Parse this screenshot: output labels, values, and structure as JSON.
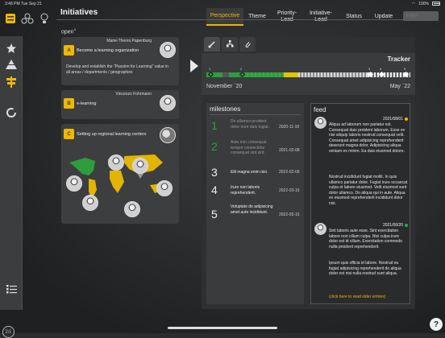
{
  "status": {
    "time": "3:48 PM",
    "date": "Tue Sep 21",
    "battery": "100%"
  },
  "page_title": "Initiatives",
  "tabs": [
    {
      "label": "Perspective",
      "active": true
    },
    {
      "label": "Theme",
      "active": false
    },
    {
      "label": "Priority-\nLead",
      "active": false
    },
    {
      "label": "Initiative-\nLead",
      "active": false
    },
    {
      "label": "Status",
      "active": false
    },
    {
      "label": "Update",
      "active": false
    }
  ],
  "filter": {
    "placeholder": "Filter"
  },
  "list": {
    "open_label": "open",
    "open_count": "3",
    "cards": [
      {
        "owner": "Marie-Theres Papenburg",
        "badge": "A",
        "title": "Become a learning organization",
        "desc": "Develop and establish the \"Passion for Learning\" value in all areas / departments / geographies"
      },
      {
        "owner": "Vincenzo Fohrmann",
        "badge": "B",
        "title": "e-learning",
        "desc": ""
      },
      {
        "owner": "",
        "badge": "C",
        "title": "Setting up regional learning centers",
        "desc": ""
      }
    ]
  },
  "tracker": {
    "title": "Tracker",
    "start": "November `20",
    "end": "May `22",
    "markers": [
      "1",
      "2",
      "3",
      "4",
      "5"
    ]
  },
  "milestones": {
    "title": "milestones",
    "items": [
      {
        "num": "1",
        "text": "Do ullamco proident dolor irure duis fugiat.",
        "date": "2020-11-19",
        "status": "done"
      },
      {
        "num": "2",
        "text": "Aute non consequat tempor consectetur consequat sint sint.",
        "date": "2021-02-08",
        "status": "done"
      },
      {
        "num": "3",
        "text": "Elit magna enim nisi.",
        "date": "2022-02-09",
        "status": "open"
      },
      {
        "num": "4",
        "text": "Irure non laboris reprehenderit.",
        "date": "2022-03-15",
        "status": "open"
      },
      {
        "num": "5",
        "text": "Voluptate do adipisicing amet aute incididunt.",
        "date": "2022-05-15",
        "status": "open"
      }
    ]
  },
  "feed": {
    "title": "feed",
    "items": [
      {
        "date": "2021/08/01",
        "dot_color": "#f4b400",
        "p1": "Aliqua ad laborum non pariatur est. Consequat duis proident laborum. Esse ex nisi aliquip laboris nostrud consequat velit. Consequat amet adipisicing reprehenderit deserunt magna dolor. Adipisicing aliqua veniam ex minim. Ea duis eiusmod dolore.",
        "p2": "Nostrud incididunt fugiat mollit. In quis ullamco pariatur dolor. Fugiat irure occaecat culpa et labore eiusmod. Velit eiusmod sunt dolor ullamco. Do aliqua qui in aute. Aliqua ex eiusmod reprehenderit incididunt dolor nisi."
      },
      {
        "date": "2021/06/20",
        "dot_color": "#2ea84a",
        "p1": "Sint laboris aute esse. Sint exercitation labore non cillum culpa. Nisi culpa irure dolor est id cillum. Exercitation commodo nulla proident reprehenderit.",
        "p2": "Ipsum quis officia id labore. Nostrud eu fugiat adipisicing reprehenderit do aliqua dolor est nisi nulla nostrud sunt aliqua."
      }
    ],
    "older_link": "(click here to read older entries)"
  },
  "rail": {
    "version": "v2.8",
    "ate": "ATE"
  },
  "colors": {
    "accent": "#f4b400",
    "done": "#2ea84a"
  }
}
